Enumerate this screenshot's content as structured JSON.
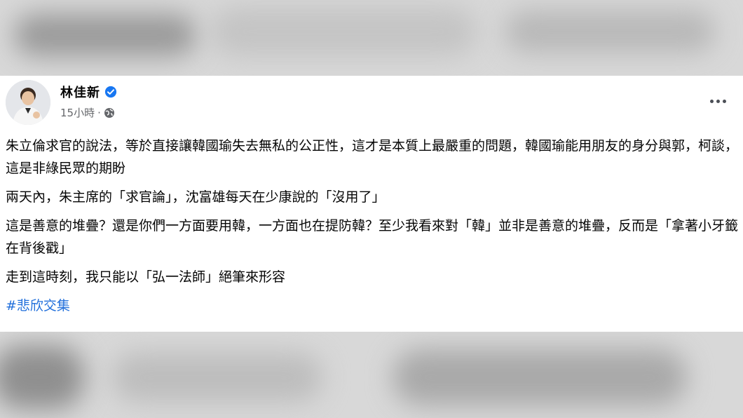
{
  "post": {
    "author": "林佳新",
    "timestamp": "15小時",
    "meta_separator": "·",
    "privacy_icon": "globe-icon",
    "verified_icon": "verified-badge-icon",
    "more_icon": "more-options-icon",
    "paragraphs": [
      "朱立倫求官的說法，等於直接讓韓國瑜失去無私的公正性，這才是本質上最嚴重的問題，韓國瑜能用朋友的身分與郭，柯談，這是非綠民眾的期盼",
      "兩天內，朱主席的「求官論」，沈富雄每天在少康說的「沒用了」",
      "這是善意的堆疊？還是你們一方面要用韓，一方面也在提防韓？至少我看來對「韓」並非是善意的堆疊，反而是「拿著小牙籤在背後戳」",
      "走到這時刻，我只能以「弘一法師」絕筆來形容"
    ],
    "hashtag": "#悲欣交集",
    "colors": {
      "text": "#050505",
      "meta": "#65676b",
      "link": "#216fdb",
      "verified": "#1877f2"
    }
  }
}
